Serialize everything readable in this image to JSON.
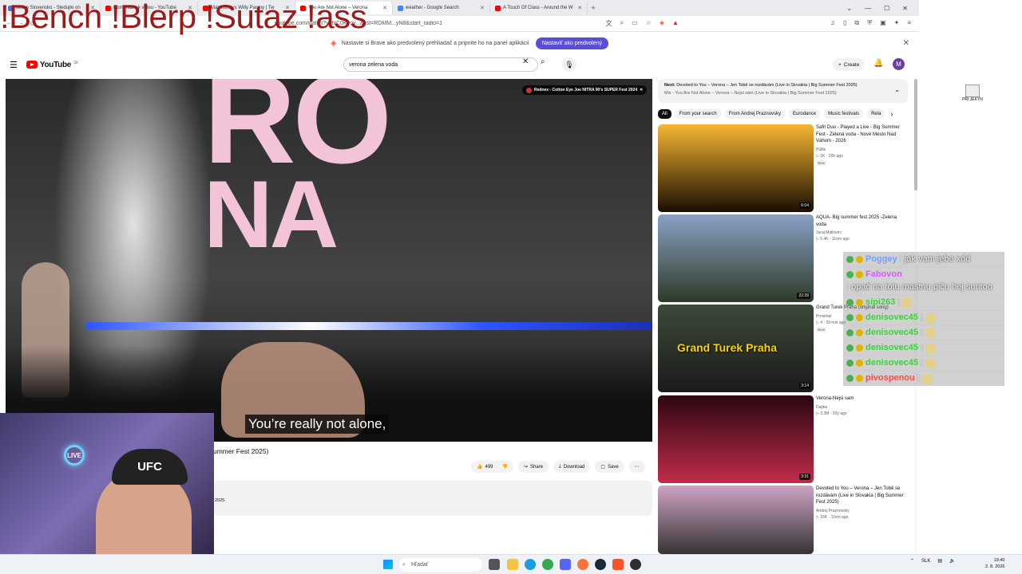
{
  "tabs": [
    {
      "label": "Shore Slovensko - Sledujte on",
      "color": "#3b7be0",
      "active": false
    },
    {
      "label": "Komentáre k videu - YouTube",
      "color": "#ff0000",
      "active": false
    },
    {
      "label": "Makkovič vs Willy Pasmy | Tw",
      "color": "#ff0000",
      "active": false
    },
    {
      "label": "You Are Not Alone – Verona",
      "color": "#ff0000",
      "active": true
    },
    {
      "label": "weather - Google Search",
      "color": "#4285f4",
      "active": false
    },
    {
      "label": "A Touch Of Class - Around the W",
      "color": "#ff0000",
      "active": false
    }
  ],
  "window_controls": [
    "⌄",
    "—",
    "☐",
    "✕"
  ],
  "address": {
    "url": "youtube.com/watch?v=fxC0Kvoy...&list=RDMM...yN8&start_radio=1"
  },
  "infobar": {
    "text": "Nastavte si Brave ako predvolený prehliadač a pripnite ho na panel aplikácií",
    "button": "Nastaviť ako predvolený"
  },
  "youtube": {
    "logo": "YouTube",
    "region": "SK",
    "search_value": "verona zelena voda",
    "create_label": "Create",
    "avatar_letter": "M"
  },
  "video": {
    "stage_text_1": "RO",
    "stage_text_2": "NA",
    "caption": "You’re really not alone,",
    "now_playing_chip": "Rednex - Cotton Eye Joe NITRA 90's SUPER Fest 2024",
    "title_fragment": "ummer Fest 2025)",
    "description_fragment": "2025."
  },
  "actions": {
    "likes": "499",
    "share": "Share",
    "download": "Download",
    "save": "Save"
  },
  "next": {
    "label": "Next:",
    "title": "Devoted to You – Verona – Jen Tobě se rozdávám (Live in Slovakia | Big Summer Fest 2025)",
    "sub": "Mix - You Are Not Alone – Verona – Nejsi sám (Live in Slovakia | Big Summer Fest 2025)"
  },
  "chips": [
    "All",
    "From your search",
    "From Andrej Praznovsky",
    "Eurodance",
    "Music festivals",
    "Rela"
  ],
  "recommendations": [
    {
      "title": "Safri Duo - Played a Live - Big Summer Fest - Zelená voda - Nové Mesto Nad Váhom - 2026",
      "channel": "Püllik",
      "meta": "1K · 20h ago",
      "badge": "New",
      "duration": "6:04",
      "thumb_colors": [
        "#f7b733",
        "#1a0d00"
      ]
    },
    {
      "title": "AQUA- Big summer fest 2025 -Zelena voda",
      "channel": "Juraj Mallovec",
      "meta": "5.4K · 11mo ago",
      "badge": "",
      "duration": "22:39",
      "thumb_colors": [
        "#8aa1c6",
        "#2d3a28"
      ]
    },
    {
      "title": "Grand Turek Praha (original song)",
      "channel": "Proximal",
      "meta": "4 · 39 min ago",
      "badge": "New",
      "duration": "3:14",
      "thumb_colors": [
        "#3d4a3a",
        "#1a1a1a"
      ],
      "overlay": "Grand Turek Praha"
    },
    {
      "title": "Verona-Nejsi sam",
      "channel": "Daijka",
      "meta": "3.3M · 20y ago",
      "badge": "",
      "duration": "3:31",
      "thumb_colors": [
        "#2b0710",
        "#c12c4b"
      ]
    },
    {
      "title": "Devoted to You – Verona – Jen Tobě se rozdávám (Live in Slovakia | Big Summer Fest 2025)",
      "channel": "Andrej Praznovsky",
      "meta": "16K · 11mo ago",
      "badge": "",
      "duration": "",
      "thumb_colors": [
        "#cfa3c5",
        "#333"
      ]
    }
  ],
  "overlay_title": "!Bench !Blerp !Sutaz !ass",
  "webcam": {
    "cap_text": "UFC",
    "neon_text": "LIVE"
  },
  "chat": [
    {
      "user": "Poggey",
      "msg": ": jak vam jebe xdd",
      "user_color": "b",
      "emote": false
    },
    {
      "user": "Fabovon",
      "msg": ": opač na totu mastnu piču hej suntoo",
      "user_color": "p",
      "emote": false
    },
    {
      "user": "sipi263",
      "msg": ":",
      "user_color": "",
      "emote": true
    },
    {
      "user": "denisovec45",
      "msg": ":",
      "user_color": "",
      "emote": true
    },
    {
      "user": "denisovec45",
      "msg": ":",
      "user_color": "",
      "emote": true
    },
    {
      "user": "denisovec45",
      "msg": ":",
      "user_color": "",
      "emote": true
    },
    {
      "user": "denisovec45",
      "msg": ":",
      "user_color": "",
      "emote": true
    },
    {
      "user": "pivospenou",
      "msg": ":",
      "user_color": "r",
      "emote": true
    }
  ],
  "desktop_icon_label": "PŘI.JEKYN",
  "taskbar": {
    "search_placeholder": "Hľadať",
    "lang": "SLK",
    "time": "19:40",
    "date": "2. 8. 2026"
  }
}
